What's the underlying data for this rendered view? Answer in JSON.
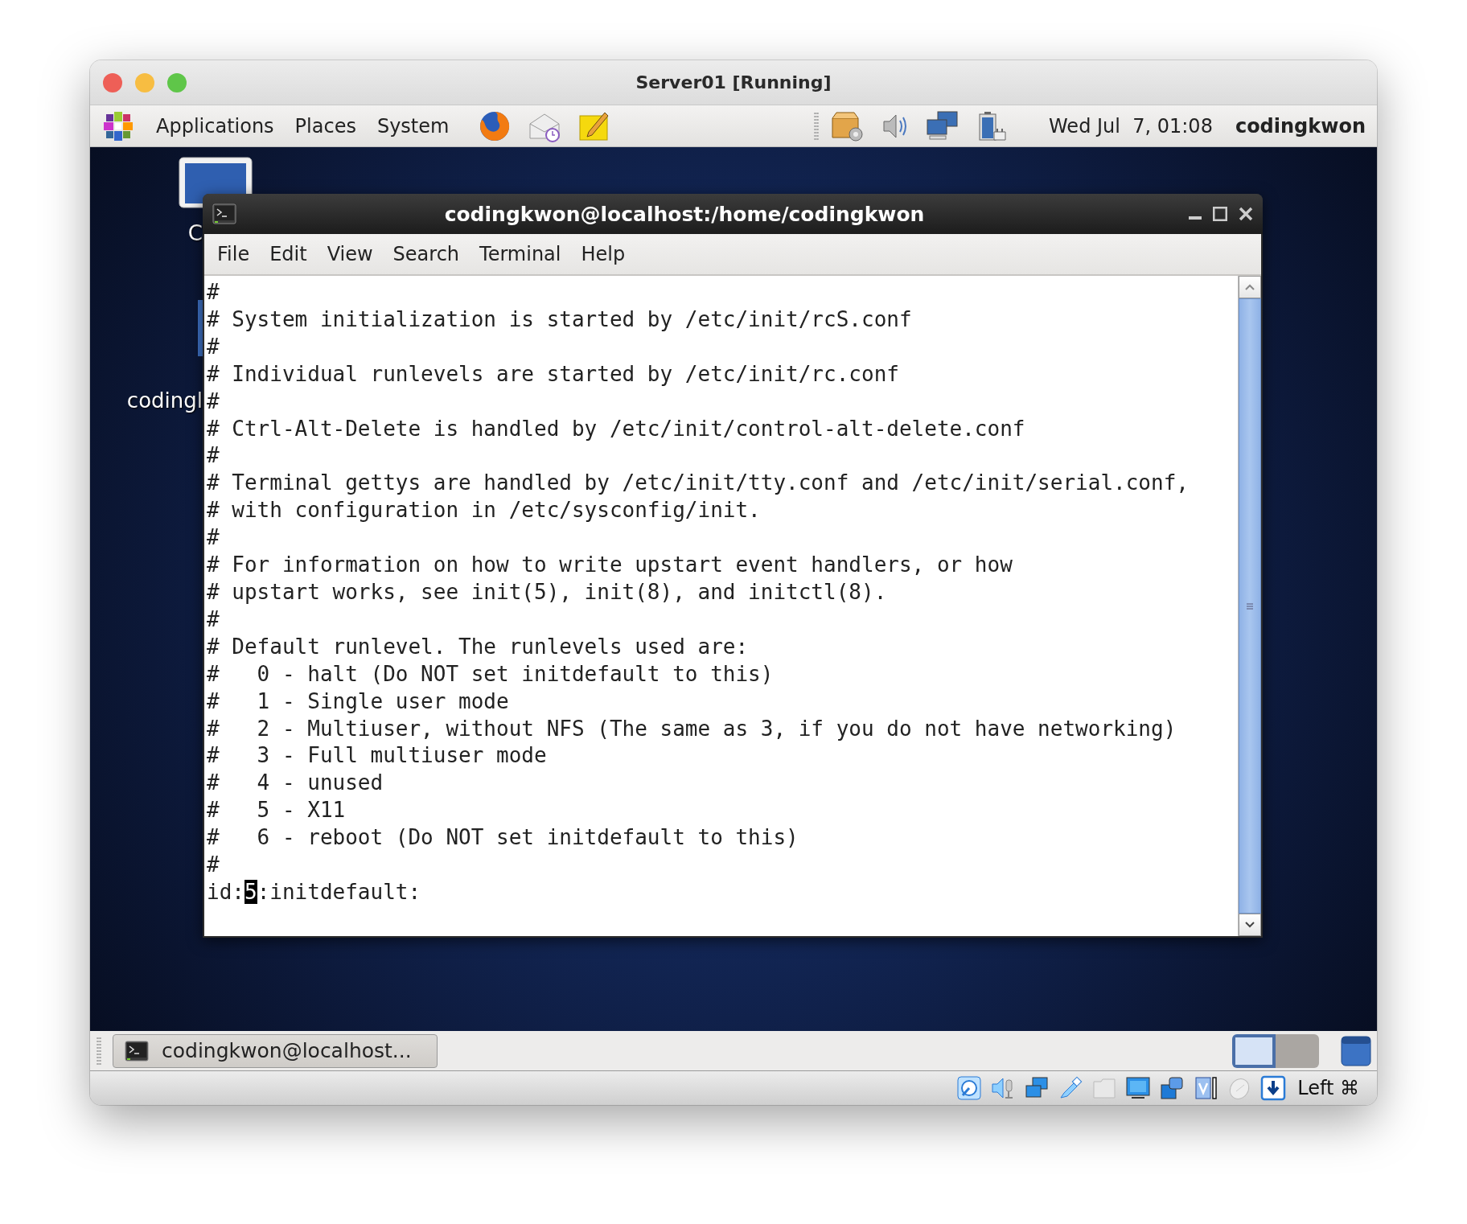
{
  "window": {
    "title": "Server01 [Running]"
  },
  "panel": {
    "menus": [
      "Applications",
      "Places",
      "System"
    ],
    "clock": "Wed Jul  7, 01:08",
    "user": "codingkwon"
  },
  "desktop": {
    "icons": [
      {
        "label": "C"
      },
      {
        "label": "codingl"
      }
    ]
  },
  "terminal": {
    "title": "codingkwon@localhost:/home/codingkwon",
    "menu": [
      "File",
      "Edit",
      "View",
      "Search",
      "Terminal",
      "Help"
    ],
    "lines": [
      "#",
      "# System initialization is started by /etc/init/rcS.conf",
      "#",
      "# Individual runlevels are started by /etc/init/rc.conf",
      "#",
      "# Ctrl-Alt-Delete is handled by /etc/init/control-alt-delete.conf",
      "#",
      "# Terminal gettys are handled by /etc/init/tty.conf and /etc/init/serial.conf,",
      "# with configuration in /etc/sysconfig/init.",
      "#",
      "# For information on how to write upstart event handlers, or how",
      "# upstart works, see init(5), init(8), and initctl(8).",
      "#",
      "# Default runlevel. The runlevels used are:",
      "#   0 - halt (Do NOT set initdefault to this)",
      "#   1 - Single user mode",
      "#   2 - Multiuser, without NFS (The same as 3, if you do not have networking)",
      "#   3 - Full multiuser mode",
      "#   4 - unused",
      "#   5 - X11",
      "#   6 - reboot (Do NOT set initdefault to this)",
      "#"
    ],
    "cursor_line": {
      "before": "id:",
      "cursor": "5",
      "after": ":initdefault:"
    }
  },
  "taskbar": {
    "tasks": [
      {
        "label": "codingkwon@localhost..."
      }
    ],
    "workspaces": [
      {
        "selected": true
      },
      {
        "selected": false
      }
    ]
  },
  "status_bar": {
    "host_key": "Left ⌘"
  }
}
